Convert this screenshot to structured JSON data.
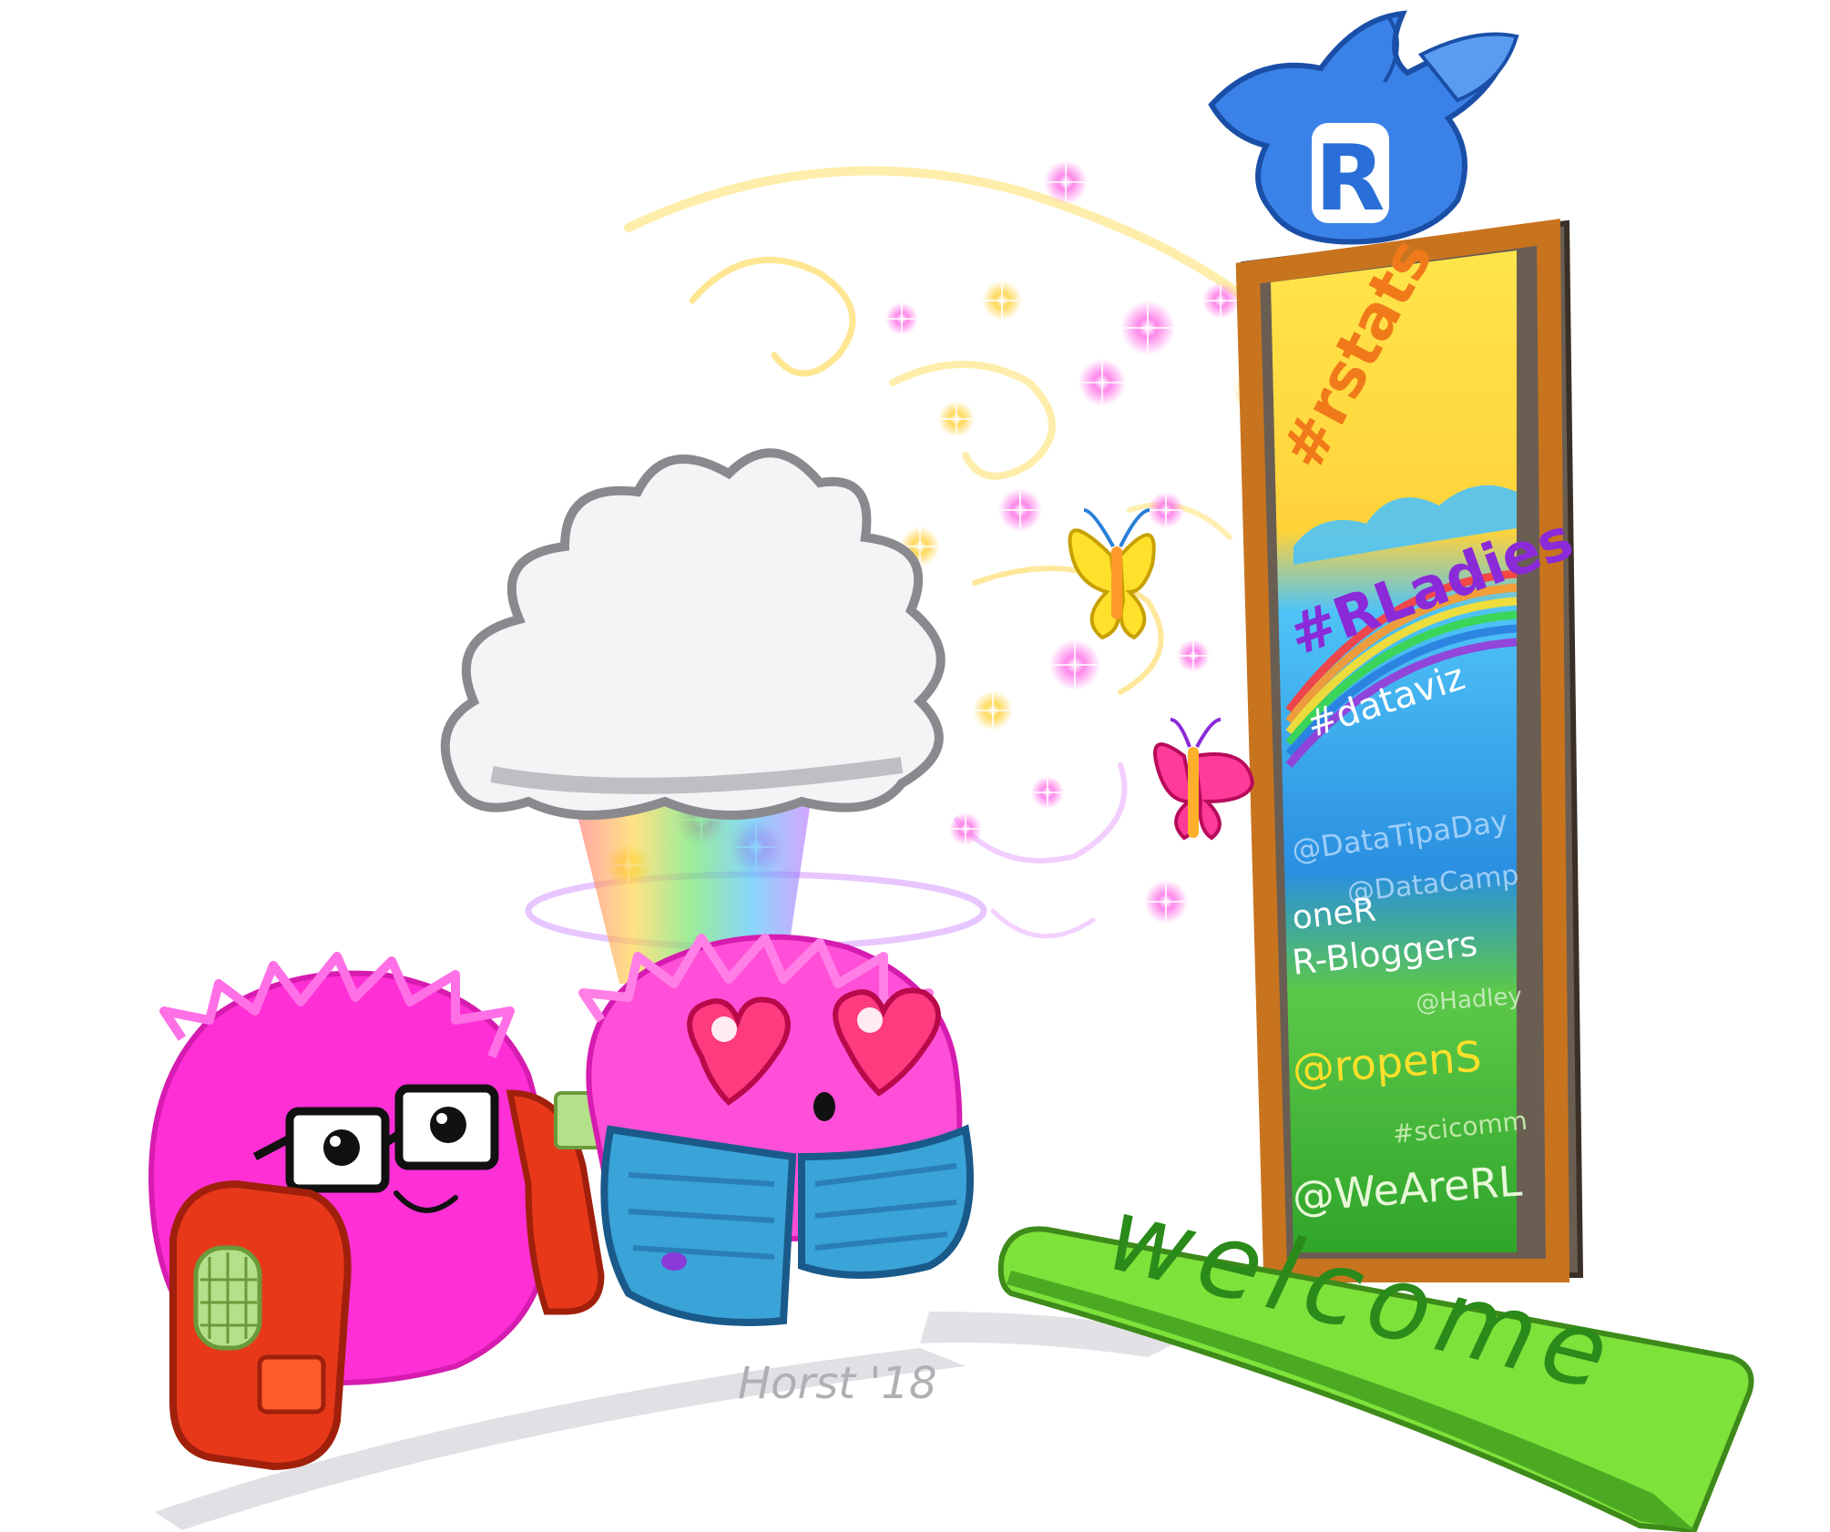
{
  "bird": {
    "letter": "R",
    "color": "#3b82e8"
  },
  "portal": {
    "frame_color": "#c8741f",
    "tags": [
      "#rstats",
      "#RLadies",
      "#dataviz",
      "@DataTipaDay",
      "@DataCamp",
      "oneR",
      "R-Bloggers",
      "@Hadley",
      "@ropenS",
      "#scicomm",
      "@WeAreRL"
    ]
  },
  "mat": {
    "label": "welcome",
    "color": "#7de23a"
  },
  "signature": "Horst '18",
  "characters": {
    "left": {
      "fur": "#ff2fd6",
      "jacket": "#e8381a",
      "expression": "smile"
    },
    "right": {
      "fur": "#ff4fd8",
      "jacket": "#3aa3d8",
      "expression": "heart-eyes"
    }
  }
}
